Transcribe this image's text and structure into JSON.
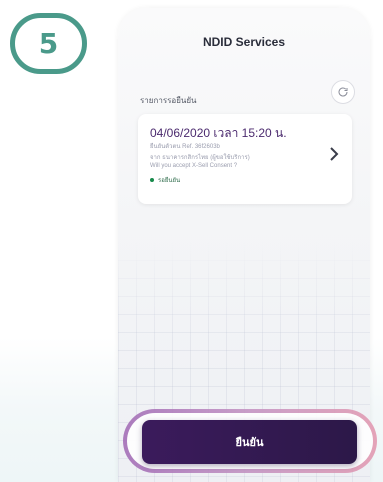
{
  "step": {
    "number": "5"
  },
  "header": {
    "title": "NDID Services"
  },
  "pending": {
    "section_label": "รายการรอยืนยัน",
    "card": {
      "datetime": "04/06/2020 เวลา 15:20 น.",
      "ref": "ยืนยันตัวตน Ref. 36f2603b",
      "line2": "จาก ธนาคารกสิกรไทย (ผู้ขอใช้บริการ)",
      "line3": "Will you accept X-Sell Consent ?",
      "status": "รอยืนยัน"
    }
  },
  "actions": {
    "confirm_label": "ยืนยัน"
  },
  "colors": {
    "badge": "#4a9a8a",
    "accent_purple": "#3b1b5c",
    "ring_gradient_start": "#a46fb8",
    "ring_gradient_end": "#e39bb2",
    "status_dot": "#178a4b"
  },
  "icons": {
    "refresh": "refresh-icon",
    "chevron": "chevron-right-icon",
    "status": "status-dot-icon"
  }
}
